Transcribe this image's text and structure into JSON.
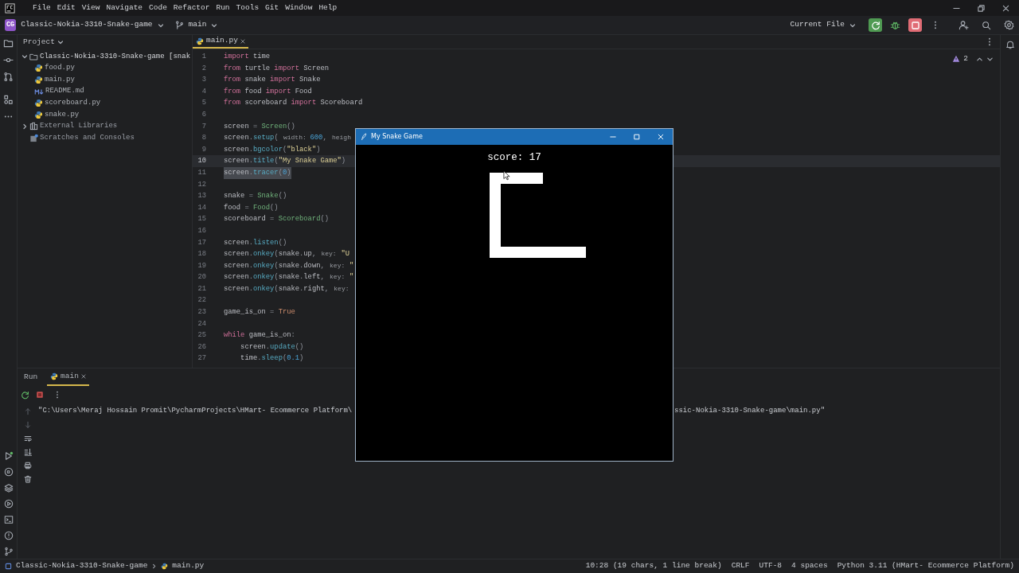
{
  "menu": [
    "File",
    "Edit",
    "View",
    "Navigate",
    "Code",
    "Refactor",
    "Run",
    "Tools",
    "Git",
    "Window",
    "Help"
  ],
  "toolbar": {
    "project_badge": "CG",
    "project": "Classic-Nokia-3310-Snake-game",
    "branch": "main",
    "run_config": "Current File"
  },
  "project_panel": {
    "title": "Project",
    "tree": [
      {
        "label": "Classic-Nokia-3310-Snake-game [snak",
        "kind": "folder",
        "expanded": true,
        "children": [
          {
            "label": "food.py",
            "kind": "python"
          },
          {
            "label": "main.py",
            "kind": "python"
          },
          {
            "label": "README.md",
            "kind": "markdown"
          },
          {
            "label": "scoreboard.py",
            "kind": "python"
          },
          {
            "label": "snake.py",
            "kind": "python"
          }
        ]
      },
      {
        "label": "External Libraries",
        "kind": "library",
        "expanded": false
      },
      {
        "label": "Scratches and Consoles",
        "kind": "scratches"
      }
    ]
  },
  "editor": {
    "tabs": [
      {
        "label": "main.py",
        "selected": true
      }
    ],
    "problems": "2",
    "lines": [
      {
        "number": "1",
        "current": false,
        "selected": false,
        "tokens": [
          {
            "text": "import",
            "kind": "kw"
          },
          {
            "text": " time",
            "kind": "plain"
          }
        ]
      },
      {
        "number": "2",
        "current": false,
        "selected": false,
        "tokens": [
          {
            "text": "from",
            "kind": "kw"
          },
          {
            "text": " turtle ",
            "kind": "plain"
          },
          {
            "text": "import",
            "kind": "kw"
          },
          {
            "text": " Screen",
            "kind": "plain"
          }
        ]
      },
      {
        "number": "3",
        "current": false,
        "selected": false,
        "tokens": [
          {
            "text": "from",
            "kind": "kw"
          },
          {
            "text": " snake ",
            "kind": "plain"
          },
          {
            "text": "import",
            "kind": "kw"
          },
          {
            "text": " Snake",
            "kind": "plain"
          }
        ]
      },
      {
        "number": "4",
        "current": false,
        "selected": false,
        "tokens": [
          {
            "text": "from",
            "kind": "kw"
          },
          {
            "text": " food ",
            "kind": "plain"
          },
          {
            "text": "import",
            "kind": "kw"
          },
          {
            "text": " Food",
            "kind": "plain"
          }
        ]
      },
      {
        "number": "5",
        "current": false,
        "selected": false,
        "tokens": [
          {
            "text": "from",
            "kind": "kw"
          },
          {
            "text": " scoreboard ",
            "kind": "plain"
          },
          {
            "text": "import",
            "kind": "kw"
          },
          {
            "text": " Scoreboard",
            "kind": "plain"
          }
        ]
      },
      {
        "number": "6",
        "current": false,
        "selected": false
      },
      {
        "number": "7",
        "current": false,
        "selected": false,
        "tokens": [
          {
            "text": "screen",
            "kind": "plain"
          },
          {
            "text": " = ",
            "kind": "punct"
          },
          {
            "text": "Screen",
            "kind": "call"
          },
          {
            "text": "()",
            "kind": "punct"
          }
        ]
      },
      {
        "number": "8",
        "current": false,
        "selected": false,
        "tokens": [
          {
            "text": "screen",
            "kind": "plain"
          },
          {
            "text": ".",
            "kind": "punct"
          },
          {
            "text": "setup",
            "kind": "method"
          },
          {
            "text": "( ",
            "kind": "punct"
          },
          {
            "text": "width: ",
            "kind": "hint"
          },
          {
            "text": "600",
            "kind": "num"
          },
          {
            "text": ", ",
            "kind": "punct"
          },
          {
            "text": "heigh",
            "kind": "hint"
          }
        ]
      },
      {
        "number": "9",
        "current": false,
        "selected": false,
        "tokens": [
          {
            "text": "screen",
            "kind": "plain"
          },
          {
            "text": ".",
            "kind": "punct"
          },
          {
            "text": "bgcolor",
            "kind": "method"
          },
          {
            "text": "(",
            "kind": "punct"
          },
          {
            "text": "\"black\"",
            "kind": "str"
          },
          {
            "text": ")",
            "kind": "punct"
          }
        ]
      },
      {
        "number": "10",
        "current": true,
        "selected": false,
        "tokens": [
          {
            "text": "screen",
            "kind": "plain"
          },
          {
            "text": ".",
            "kind": "punct"
          },
          {
            "text": "title",
            "kind": "method"
          },
          {
            "text": "(",
            "kind": "punct"
          },
          {
            "text": "\"My Snake Game\"",
            "kind": "str"
          },
          {
            "text": ")",
            "kind": "punct"
          }
        ]
      },
      {
        "number": "11",
        "current": false,
        "selected": true,
        "tokens": [
          {
            "text": "screen",
            "kind": "plain"
          },
          {
            "text": ".",
            "kind": "punct"
          },
          {
            "text": "tracer",
            "kind": "method"
          },
          {
            "text": "(",
            "kind": "punct"
          },
          {
            "text": "0",
            "kind": "num"
          },
          {
            "text": ")",
            "kind": "punct"
          }
        ]
      },
      {
        "number": "12",
        "current": false,
        "selected": false
      },
      {
        "number": "13",
        "current": false,
        "selected": false,
        "tokens": [
          {
            "text": "snake",
            "kind": "plain"
          },
          {
            "text": " = ",
            "kind": "punct"
          },
          {
            "text": "Snake",
            "kind": "call"
          },
          {
            "text": "()",
            "kind": "punct"
          }
        ]
      },
      {
        "number": "14",
        "current": false,
        "selected": false,
        "tokens": [
          {
            "text": "food",
            "kind": "plain"
          },
          {
            "text": " = ",
            "kind": "punct"
          },
          {
            "text": "Food",
            "kind": "call"
          },
          {
            "text": "()",
            "kind": "punct"
          }
        ]
      },
      {
        "number": "15",
        "current": false,
        "selected": false,
        "tokens": [
          {
            "text": "scoreboard",
            "kind": "plain"
          },
          {
            "text": " = ",
            "kind": "punct"
          },
          {
            "text": "Scoreboard",
            "kind": "call"
          },
          {
            "text": "()",
            "kind": "punct"
          }
        ]
      },
      {
        "number": "16",
        "current": false,
        "selected": false
      },
      {
        "number": "17",
        "current": false,
        "selected": false,
        "tokens": [
          {
            "text": "screen",
            "kind": "plain"
          },
          {
            "text": ".",
            "kind": "punct"
          },
          {
            "text": "listen",
            "kind": "method"
          },
          {
            "text": "()",
            "kind": "punct"
          }
        ]
      },
      {
        "number": "18",
        "current": false,
        "selected": false,
        "tokens": [
          {
            "text": "screen",
            "kind": "plain"
          },
          {
            "text": ".",
            "kind": "punct"
          },
          {
            "text": "onkey",
            "kind": "method"
          },
          {
            "text": "(",
            "kind": "punct"
          },
          {
            "text": "snake",
            "kind": "plain"
          },
          {
            "text": ".",
            "kind": "punct"
          },
          {
            "text": "up",
            "kind": "plain"
          },
          {
            "text": ", ",
            "kind": "punct"
          },
          {
            "text": "key: ",
            "kind": "hint"
          },
          {
            "text": "\"U",
            "kind": "str"
          }
        ]
      },
      {
        "number": "19",
        "current": false,
        "selected": false,
        "tokens": [
          {
            "text": "screen",
            "kind": "plain"
          },
          {
            "text": ".",
            "kind": "punct"
          },
          {
            "text": "onkey",
            "kind": "method"
          },
          {
            "text": "(",
            "kind": "punct"
          },
          {
            "text": "snake",
            "kind": "plain"
          },
          {
            "text": ".",
            "kind": "punct"
          },
          {
            "text": "down",
            "kind": "plain"
          },
          {
            "text": ", ",
            "kind": "punct"
          },
          {
            "text": "key: ",
            "kind": "hint"
          },
          {
            "text": "\"",
            "kind": "str"
          }
        ]
      },
      {
        "number": "20",
        "current": false,
        "selected": false,
        "tokens": [
          {
            "text": "screen",
            "kind": "plain"
          },
          {
            "text": ".",
            "kind": "punct"
          },
          {
            "text": "onkey",
            "kind": "method"
          },
          {
            "text": "(",
            "kind": "punct"
          },
          {
            "text": "snake",
            "kind": "plain"
          },
          {
            "text": ".",
            "kind": "punct"
          },
          {
            "text": "left",
            "kind": "plain"
          },
          {
            "text": ", ",
            "kind": "punct"
          },
          {
            "text": "key: ",
            "kind": "hint"
          },
          {
            "text": "\"",
            "kind": "str"
          }
        ]
      },
      {
        "number": "21",
        "current": false,
        "selected": false,
        "tokens": [
          {
            "text": "screen",
            "kind": "plain"
          },
          {
            "text": ".",
            "kind": "punct"
          },
          {
            "text": "onkey",
            "kind": "method"
          },
          {
            "text": "(",
            "kind": "punct"
          },
          {
            "text": "snake",
            "kind": "plain"
          },
          {
            "text": ".",
            "kind": "punct"
          },
          {
            "text": "right",
            "kind": "plain"
          },
          {
            "text": ", ",
            "kind": "punct"
          },
          {
            "text": "key:",
            "kind": "hint"
          }
        ]
      },
      {
        "number": "22",
        "current": false,
        "selected": false
      },
      {
        "number": "23",
        "current": false,
        "selected": false,
        "tokens": [
          {
            "text": "game_is_on",
            "kind": "plain"
          },
          {
            "text": " = ",
            "kind": "punct"
          },
          {
            "text": "True",
            "kind": "const"
          }
        ]
      },
      {
        "number": "24",
        "current": false,
        "selected": false
      },
      {
        "number": "25",
        "current": false,
        "selected": false,
        "tokens": [
          {
            "text": "while",
            "kind": "kw"
          },
          {
            "text": " game_is_on",
            "kind": "plain"
          },
          {
            "text": ":",
            "kind": "punct"
          }
        ]
      },
      {
        "number": "26",
        "current": false,
        "selected": false,
        "tokens": [
          {
            "text": "    screen",
            "kind": "plain"
          },
          {
            "text": ".",
            "kind": "punct"
          },
          {
            "text": "update",
            "kind": "method"
          },
          {
            "text": "()",
            "kind": "punct"
          }
        ]
      },
      {
        "number": "27",
        "current": false,
        "selected": false,
        "tokens": [
          {
            "text": "    time",
            "kind": "plain"
          },
          {
            "text": ".",
            "kind": "punct"
          },
          {
            "text": "sleep",
            "kind": "method"
          },
          {
            "text": "(",
            "kind": "punct"
          },
          {
            "text": "0.1",
            "kind": "num"
          },
          {
            "text": ")",
            "kind": "punct"
          }
        ]
      }
    ]
  },
  "game_window": {
    "title": "My Snake Game",
    "score": "score: 17"
  },
  "run_panel": {
    "title": "Run",
    "tabs": [
      {
        "label": "main",
        "selected": true
      }
    ],
    "console": [
      "\"C:\\Users\\Meraj Hossain Promit\\PycharmProjects\\HMart- Ecommerce Platform\\",
      "ssic-Nokia-3310-Snake-game\\main.py\""
    ]
  },
  "status_bar": {
    "breadcrumbs": [
      {
        "label": "Classic-Nokia-3310-Snake-game",
        "kind": "module"
      },
      {
        "label": "main.py",
        "kind": "python"
      }
    ],
    "items": [
      "10:28 (19 chars, 1 line break)",
      "CRLF",
      "UTF-8",
      "4 spaces",
      "Python 3.11 (HMart- Ecommerce Platform)"
    ]
  }
}
